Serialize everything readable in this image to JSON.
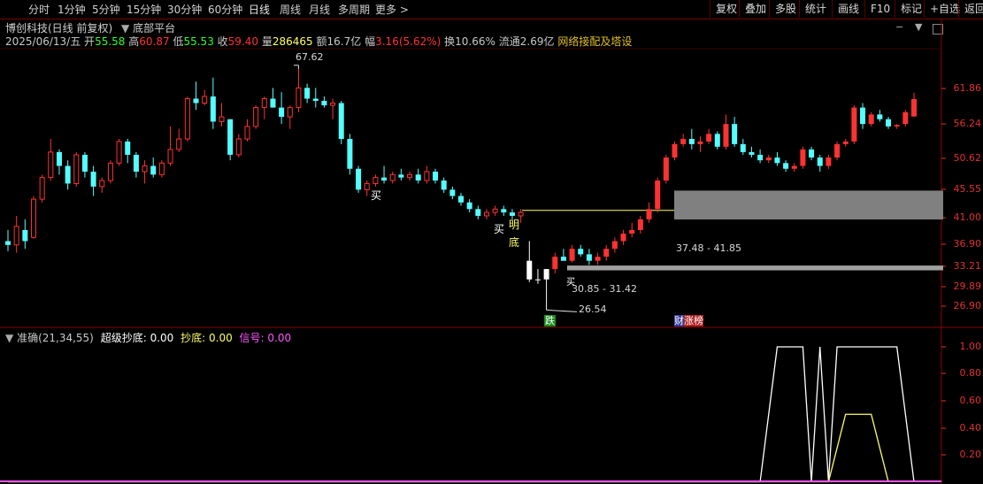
{
  "toolbar": {
    "periods": [
      "分时",
      "1分钟",
      "5分钟",
      "15分钟",
      "30分钟",
      "60分钟",
      "日线",
      "周线",
      "月线",
      "多周期",
      "更多 >"
    ],
    "active_period": "日线",
    "right_buttons": [
      "复权",
      "叠加",
      "多股",
      "统计",
      "画线",
      "F10",
      "标记",
      "+自选",
      "返回"
    ]
  },
  "stock": {
    "title": "博创科技(日线 前复权)",
    "indicator_name": "底部平台",
    "date": "2025/06/13/五",
    "open_label": "开",
    "open": "55.58",
    "high_label": "高",
    "high": "60.87",
    "low_label": "低",
    "low": "55.53",
    "close_label": "收",
    "close": "59.40",
    "volume_label": "量",
    "volume": "286465",
    "amount_label": "额",
    "amount": "16.7亿",
    "change_label": "幅",
    "change": "3.16(5.62%)",
    "turnover_label": "换",
    "turnover": "10.66%",
    "float_label": "流通",
    "float_cap": "2.69亿",
    "concept": "网络接配及塔设"
  },
  "price_axis": [
    "61.86",
    "56.24",
    "50.62",
    "45.55",
    "41.00",
    "36.90",
    "33.21",
    "29.89",
    "26.90"
  ],
  "indicator_axis": [
    "1.00",
    "0.80",
    "0.60",
    "0.40",
    "0.20"
  ],
  "annotations": {
    "high_mark": "67.62",
    "low_mark": "26.54",
    "zone_upper": "37.48 - 41.85",
    "zone_lower": "30.85 - 31.42",
    "buy1": "买",
    "buy2": "买",
    "ming": "明",
    "di": "底",
    "mai": "买",
    "die_tag": "跌",
    "cai_tag": "财",
    "zhang_tag": "涨榜"
  },
  "indicator": {
    "name": "准确(21,34,55)",
    "sup_label": "超级抄底:",
    "sup_value": "0.00",
    "chao_label": "抄底:",
    "chao_value": "0.00",
    "sig_label": "信号:",
    "sig_value": "0.00"
  },
  "colors": {
    "up": "#ff3232",
    "down": "#54ffff",
    "flat": "#ffffff",
    "axis_red": "#e03030",
    "separator": "#8b0000",
    "yellow": "#ffff66",
    "magenta": "#ff55ff",
    "zone_gray": "#808080"
  },
  "chart_data": {
    "type": "candlestick",
    "ylim": [
      25.5,
      69
    ],
    "bars": [
      [
        34.5,
        36.0,
        33.2,
        34.0
      ],
      [
        34.0,
        38.0,
        33.0,
        36.5
      ],
      [
        36.0,
        37.5,
        33.5,
        34.5
      ],
      [
        35.0,
        41.0,
        34.8,
        40.5
      ],
      [
        40.5,
        44.5,
        40.0,
        44.0
      ],
      [
        44.0,
        51.0,
        43.5,
        48.5
      ],
      [
        48.5,
        49.0,
        44.5,
        46.0
      ],
      [
        46.0,
        47.0,
        42.0,
        43.0
      ],
      [
        43.0,
        48.5,
        42.5,
        48.0
      ],
      [
        48.0,
        48.5,
        44.0,
        45.0
      ],
      [
        45.0,
        46.0,
        41.0,
        42.5
      ],
      [
        42.5,
        44.0,
        41.5,
        43.5
      ],
      [
        43.5,
        47.0,
        43.0,
        46.5
      ],
      [
        46.5,
        51.0,
        46.0,
        50.5
      ],
      [
        50.5,
        51.0,
        46.5,
        48.0
      ],
      [
        48.0,
        48.5,
        44.0,
        45.0
      ],
      [
        45.0,
        47.0,
        43.0,
        46.0
      ],
      [
        46.0,
        47.5,
        44.0,
        44.5
      ],
      [
        44.5,
        47.0,
        44.0,
        46.5
      ],
      [
        46.5,
        53.5,
        46.0,
        49.0
      ],
      [
        49.0,
        53.0,
        48.5,
        51.0
      ],
      [
        51.0,
        60.0,
        50.5,
        59.5
      ],
      [
        59.5,
        63.5,
        57.0,
        58.5
      ],
      [
        58.5,
        61.5,
        58.0,
        60.0
      ],
      [
        60.0,
        64.5,
        53.0,
        54.5
      ],
      [
        54.5,
        58.5,
        53.5,
        55.5
      ],
      [
        55.0,
        54.0,
        47.0,
        48.0
      ],
      [
        48.0,
        52.0,
        47.5,
        51.0
      ],
      [
        51.0,
        55.0,
        50.5,
        53.5
      ],
      [
        53.5,
        58.0,
        53.0,
        57.5
      ],
      [
        57.5,
        60.0,
        55.0,
        59.5
      ],
      [
        59.5,
        62.0,
        58.5,
        57.5
      ],
      [
        57.5,
        61.0,
        54.0,
        55.5
      ],
      [
        55.5,
        58.0,
        53.0,
        57.5
      ],
      [
        57.5,
        67.6,
        56.5,
        62.0
      ],
      [
        62.0,
        63.0,
        58.5,
        59.5
      ],
      [
        59.5,
        62.0,
        57.5,
        59.0
      ],
      [
        59.0,
        60.0,
        57.5,
        58.0
      ],
      [
        58.0,
        59.5,
        55.0,
        58.5
      ],
      [
        58.5,
        59.0,
        50.0,
        51.0
      ],
      [
        51.0,
        52.0,
        44.5,
        45.5
      ],
      [
        45.5,
        46.0,
        41.5,
        42.0
      ],
      [
        42.0,
        43.5,
        41.0,
        43.0
      ],
      [
        43.0,
        44.5,
        42.5,
        44.0
      ],
      [
        44.0,
        46.0,
        43.0,
        43.5
      ],
      [
        43.5,
        45.0,
        43.0,
        44.5
      ],
      [
        44.5,
        45.5,
        43.5,
        44.0
      ],
      [
        44.0,
        45.0,
        43.5,
        44.5
      ],
      [
        44.5,
        45.5,
        43.0,
        43.5
      ],
      [
        43.5,
        46.0,
        43.0,
        45.0
      ],
      [
        45.0,
        45.5,
        43.0,
        43.5
      ],
      [
        43.5,
        44.0,
        41.5,
        42.0
      ],
      [
        42.0,
        42.5,
        40.5,
        41.0
      ],
      [
        41.0,
        41.5,
        39.5,
        40.0
      ],
      [
        40.0,
        40.5,
        38.5,
        39.0
      ],
      [
        39.0,
        39.5,
        37.5,
        38.0
      ],
      [
        38.0,
        39.0,
        37.5,
        38.5
      ],
      [
        38.5,
        39.5,
        38.0,
        39.0
      ],
      [
        39.0,
        39.5,
        38.0,
        38.5
      ],
      [
        38.5,
        39.0,
        37.5,
        38.0
      ],
      [
        38.0,
        39.0,
        37.0,
        38.5
      ],
      [
        32.0,
        34.5,
        29.5,
        29.8
      ],
      [
        29.8,
        31.0,
        29.3,
        29.8
      ],
      [
        29.8,
        31.0,
        26.5,
        31.0
      ],
      [
        31.0,
        33.0,
        30.5,
        32.5
      ],
      [
        32.5,
        33.5,
        32.0,
        32.0
      ],
      [
        32.0,
        34.0,
        31.8,
        33.5
      ],
      [
        33.5,
        34.0,
        32.5,
        32.8
      ],
      [
        32.8,
        33.5,
        31.5,
        32.0
      ],
      [
        32.0,
        33.0,
        31.5,
        32.5
      ],
      [
        32.5,
        34.0,
        32.0,
        33.5
      ],
      [
        33.5,
        35.0,
        33.0,
        34.5
      ],
      [
        34.5,
        36.0,
        34.0,
        35.5
      ],
      [
        35.5,
        37.0,
        35.0,
        36.0
      ],
      [
        36.0,
        38.0,
        35.5,
        37.5
      ],
      [
        37.5,
        40.0,
        37.0,
        39.0
      ],
      [
        39.0,
        44.0,
        38.5,
        43.5
      ],
      [
        43.5,
        48.0,
        43.0,
        47.5
      ],
      [
        47.5,
        50.5,
        47.0,
        50.0
      ],
      [
        50.0,
        52.0,
        49.5,
        51.0
      ],
      [
        51.0,
        53.0,
        49.0,
        50.0
      ],
      [
        50.0,
        51.5,
        48.5,
        50.5
      ],
      [
        50.5,
        53.0,
        50.0,
        52.0
      ],
      [
        52.0,
        52.5,
        49.0,
        49.5
      ],
      [
        49.5,
        56.0,
        49.0,
        54.0
      ],
      [
        54.0,
        55.5,
        49.5,
        50.0
      ],
      [
        50.0,
        51.0,
        48.0,
        48.5
      ],
      [
        48.5,
        49.5,
        47.5,
        48.0
      ],
      [
        48.0,
        49.0,
        46.5,
        47.0
      ],
      [
        47.0,
        48.0,
        46.5,
        47.5
      ],
      [
        47.5,
        48.5,
        46.0,
        46.5
      ],
      [
        46.5,
        47.0,
        45.0,
        45.5
      ],
      [
        45.5,
        46.5,
        45.0,
        46.0
      ],
      [
        46.0,
        49.5,
        45.5,
        49.0
      ],
      [
        49.0,
        49.5,
        47.0,
        47.5
      ],
      [
        47.5,
        48.0,
        45.0,
        46.0
      ],
      [
        46.0,
        48.0,
        45.5,
        47.5
      ],
      [
        47.5,
        50.5,
        47.0,
        50.0
      ],
      [
        50.0,
        51.0,
        49.5,
        50.5
      ],
      [
        50.5,
        58.0,
        50.0,
        57.5
      ],
      [
        57.5,
        58.5,
        53.0,
        54.0
      ],
      [
        54.0,
        56.5,
        53.5,
        56.0
      ],
      [
        56.0,
        57.0,
        54.5,
        55.0
      ],
      [
        55.0,
        55.5,
        53.0,
        53.5
      ],
      [
        53.5,
        54.0,
        53.0,
        53.8
      ],
      [
        54.0,
        57.0,
        53.5,
        56.5
      ],
      [
        55.58,
        60.87,
        55.53,
        59.4
      ]
    ],
    "platform_upper": [
      37.48,
      41.85
    ],
    "platform_lower": [
      30.85,
      31.42
    ],
    "indicator_series": [
      {
        "name": "超级抄底",
        "color": "#ffffff",
        "points": [
          [
            0,
            0
          ],
          [
            88,
            0
          ],
          [
            90,
            1
          ],
          [
            93,
            1
          ],
          [
            94,
            0
          ],
          [
            95,
            1
          ],
          [
            96,
            0
          ],
          [
            97,
            1
          ],
          [
            104,
            1
          ],
          [
            106,
            0
          ]
        ]
      },
      {
        "name": "抄底",
        "color": "#ffff66",
        "points": [
          [
            0,
            0
          ],
          [
            96,
            0
          ],
          [
            98,
            0.5
          ],
          [
            101,
            0.5
          ],
          [
            103,
            0
          ]
        ]
      }
    ]
  }
}
